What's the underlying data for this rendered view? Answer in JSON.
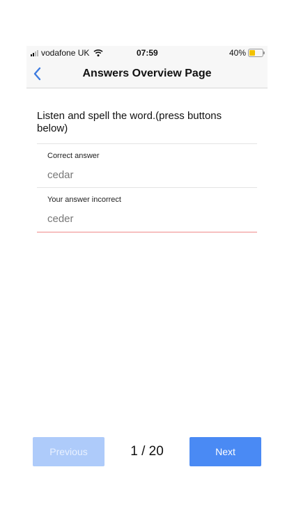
{
  "status_bar": {
    "carrier": "vodafone UK",
    "time": "07:59",
    "battery_percent": "40%",
    "battery_level": 0.4
  },
  "nav": {
    "title": "Answers Overview Page",
    "back_icon": "chevron-left-icon",
    "accent_color": "#3d7be0"
  },
  "question": {
    "prompt": "Listen and spell the word.(press buttons below)"
  },
  "answers": {
    "correct_label": "Correct answer",
    "correct_value": "cedar",
    "user_label": "Your answer incorrect",
    "user_value": "ceder",
    "error_color": "#f08a8a"
  },
  "footer": {
    "previous_label": "Previous",
    "next_label": "Next",
    "page_indicator": "1 / 20",
    "next_color": "#4a8af4",
    "previous_color": "#aecbfa"
  }
}
